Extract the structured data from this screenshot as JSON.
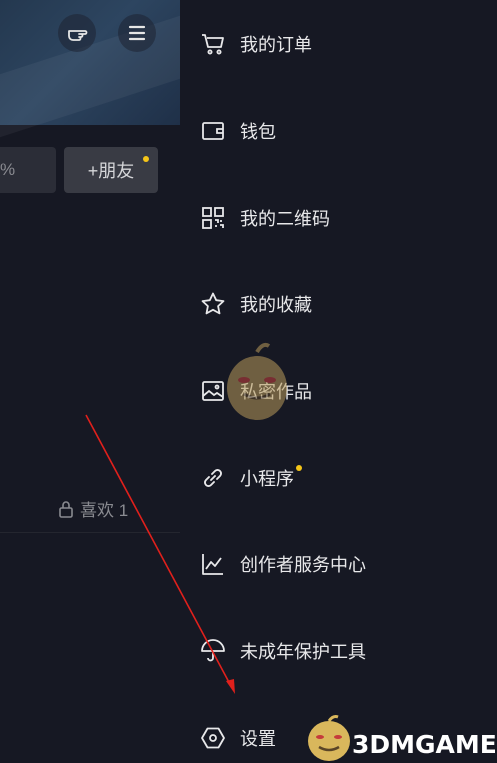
{
  "left_panel": {
    "left_button_text": "%",
    "add_friend_label": "+朋友",
    "likes_tab_label": "喜欢 1"
  },
  "drawer": {
    "items": [
      {
        "label": "我的订单",
        "icon": "cart-icon"
      },
      {
        "label": "钱包",
        "icon": "wallet-icon"
      },
      {
        "label": "我的二维码",
        "icon": "qr-code-icon"
      },
      {
        "label": "我的收藏",
        "icon": "star-icon"
      },
      {
        "label": "私密作品",
        "icon": "private-image-icon"
      },
      {
        "label": "小程序",
        "icon": "link-icon"
      },
      {
        "label": "创作者服务中心",
        "icon": "chart-icon"
      },
      {
        "label": "未成年保护工具",
        "icon": "umbrella-icon"
      },
      {
        "label": "设置",
        "icon": "hexagon-settings-icon"
      }
    ]
  },
  "watermark": {
    "text": "3DMGAME"
  },
  "colors": {
    "background": "#161823",
    "accent_dot": "#f5c518",
    "annotation_arrow": "#e0201c"
  }
}
